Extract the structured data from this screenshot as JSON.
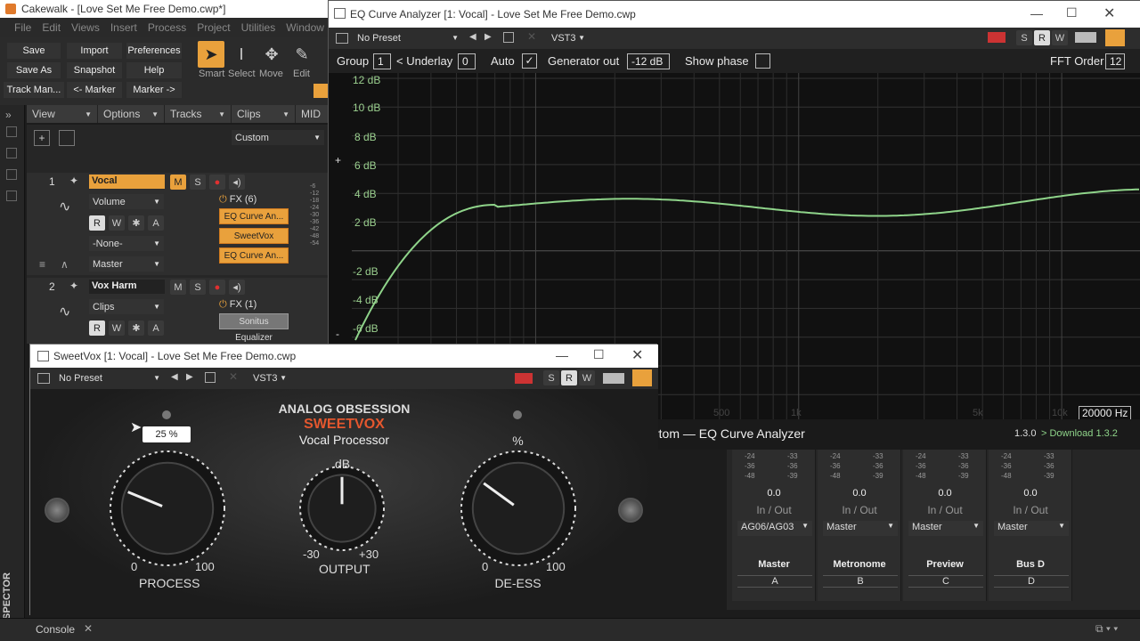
{
  "main": {
    "title": "Cakewalk - [Love Set Me Free Demo.cwp*]",
    "menu": [
      "File",
      "Edit",
      "Views",
      "Insert",
      "Process",
      "Project",
      "Utilities",
      "Window"
    ],
    "toolbar": {
      "save": "Save",
      "import": "Import",
      "preferences": "Preferences",
      "save_as": "Save As",
      "snapshot": "Snapshot",
      "help": "Help",
      "track_man": "Track Man...",
      "marker_back": "<- Marker",
      "marker_fwd": "Marker ->",
      "tools": [
        "Smart",
        "Select",
        "Move",
        "Edit"
      ]
    },
    "nav": [
      "View",
      "Options",
      "Tracks",
      "Clips",
      "MID"
    ],
    "custom_label": "Custom",
    "tracks": [
      {
        "number": "1",
        "name": "Vocal",
        "automation": "Volume",
        "input": "-None-",
        "output": "Master",
        "fx_label": "FX (6)",
        "fx": [
          "EQ Curve An...",
          "SweetVox",
          "EQ Curve An..."
        ]
      },
      {
        "number": "2",
        "name": "Vox Harm",
        "automation": "Clips",
        "fx_label": "FX (1)",
        "fx": [
          "Sonitus Equalizer"
        ]
      }
    ],
    "meter_labels": [
      "-6",
      "-12",
      "-18",
      "-24",
      "-30",
      "-36",
      "-42",
      "-48",
      "-54"
    ],
    "inspector_label": "INSPECTOR",
    "console_tab": "Console"
  },
  "eq": {
    "title": "EQ Curve Analyzer [1: Vocal] - Love Set Me Free Demo.cwp",
    "preset": "No Preset",
    "format": "VST3",
    "params": {
      "group_label": "Group",
      "group_value": "1",
      "underlay_label": "< Underlay",
      "underlay_value": "0",
      "auto_label": "Auto",
      "generator_label": "Generator out",
      "generator_value": "-12 dB",
      "show_phase_label": "Show phase",
      "fft_label": "FFT Order",
      "fft_value": "12"
    },
    "db_labels": [
      "12 dB",
      "10 dB",
      "8 dB",
      "6 dB",
      "4 dB",
      "2 dB",
      "-2 dB",
      "-4 dB",
      "-6 dB"
    ],
    "freq_labels": [
      "500",
      "1k",
      "5k",
      "10k"
    ],
    "max_freq": "20000 Hz",
    "footer_name": "rtom — EQ Curve Analyzer",
    "footer_version": "1.3.0",
    "footer_download": "> Download 1.3.2"
  },
  "console": {
    "strips": [
      {
        "value": "0.0",
        "inout": "In / Out",
        "route": "AG06/AG03",
        "name": "Master",
        "letter": "A"
      },
      {
        "value": "0.0",
        "inout": "In / Out",
        "route": "Master",
        "name": "Metronome",
        "letter": "B"
      },
      {
        "value": "0.0",
        "inout": "In / Out",
        "route": "Master",
        "name": "Preview",
        "letter": "C"
      },
      {
        "value": "0.0",
        "inout": "In / Out",
        "route": "Master",
        "name": "Bus D",
        "letter": "D"
      }
    ],
    "meter_left": [
      "-24",
      "-36",
      "-48"
    ],
    "meter_right": [
      "-33",
      "-36",
      "-39"
    ]
  },
  "sweetvox": {
    "title": "SweetVox [1: Vocal] - Love Set Me Free Demo.cwp",
    "preset": "No Preset",
    "format": "VST3",
    "brand": "ANALOG OBSESSION",
    "product": "SWEETVOX",
    "subtitle": "Vocal Processor",
    "tooltip": "25 %",
    "process": {
      "label": "PROCESS",
      "min": "0",
      "max": "100",
      "value": 25
    },
    "output": {
      "label": "OUTPUT",
      "unit": "dB",
      "min": "-30",
      "max": "+30",
      "value": 0
    },
    "deess": {
      "label": "DE-ESS",
      "unit": "%",
      "min": "0",
      "max": "100",
      "value": 30
    }
  },
  "colors": {
    "accent": "#e9a13c",
    "curve": "#8fd48a",
    "eq_label": "#9bd08f",
    "sweetvox_red": "#e4572e"
  }
}
